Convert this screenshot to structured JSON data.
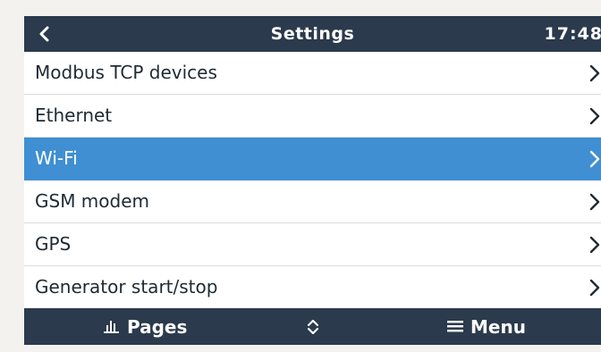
{
  "header": {
    "back_icon": "chevron-left-icon",
    "title": "Settings",
    "time": "17:48"
  },
  "list": {
    "items": [
      {
        "label": "Modbus TCP devices",
        "selected": false,
        "icon": "chevron-right-icon"
      },
      {
        "label": "Ethernet",
        "selected": false,
        "icon": "chevron-right-icon"
      },
      {
        "label": "Wi-Fi",
        "selected": true,
        "icon": "chevron-right-icon"
      },
      {
        "label": "GSM modem",
        "selected": false,
        "icon": "chevron-right-icon"
      },
      {
        "label": "GPS",
        "selected": false,
        "icon": "chevron-right-icon"
      },
      {
        "label": "Generator start/stop",
        "selected": false,
        "icon": "chevron-right-icon"
      }
    ]
  },
  "footer": {
    "pages_label": "Pages",
    "pages_icon": "bar-chart-icon",
    "updown_icon": "up-down-chevron-icon",
    "menu_label": "Menu",
    "menu_icon": "hamburger-icon"
  },
  "colors": {
    "bar_background": "#2b3a4c",
    "selected_row": "#3f8fd2",
    "page_background": "#f3f2ef"
  }
}
